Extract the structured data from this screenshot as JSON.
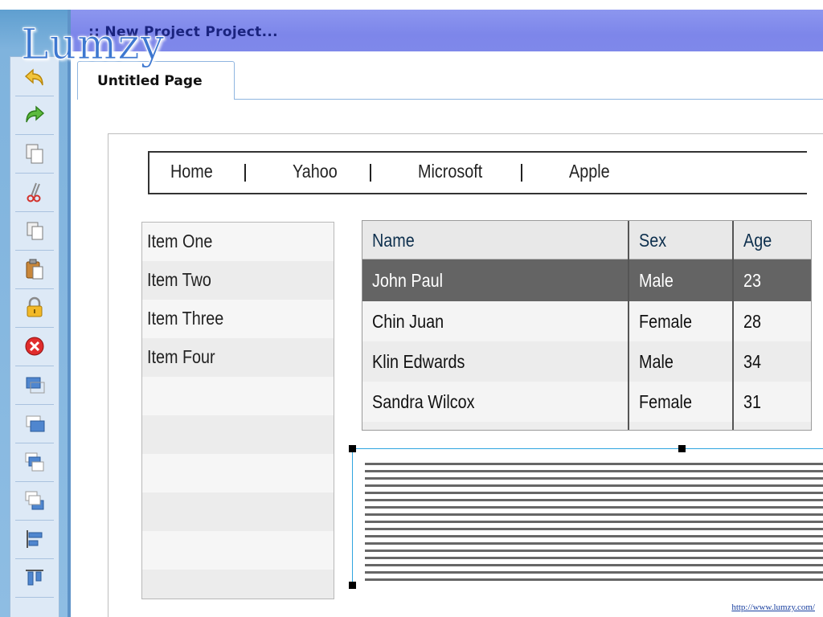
{
  "logo": "Lumzy",
  "window": {
    "title": ":: New Project Project..."
  },
  "tabs": [
    {
      "label": "Untitled Page"
    }
  ],
  "toolbar": {
    "items": [
      {
        "name": "undo-icon"
      },
      {
        "name": "redo-icon"
      },
      {
        "name": "copy-icon"
      },
      {
        "name": "cut-icon"
      },
      {
        "name": "duplicate-icon"
      },
      {
        "name": "paste-icon"
      },
      {
        "name": "lock-icon"
      },
      {
        "name": "delete-icon"
      },
      {
        "name": "bring-forward-icon"
      },
      {
        "name": "send-backward-icon"
      },
      {
        "name": "bring-to-front-icon"
      },
      {
        "name": "send-to-back-icon"
      },
      {
        "name": "align-left-icon"
      },
      {
        "name": "align-top-icon"
      }
    ]
  },
  "navbar": {
    "links": [
      "Home",
      "Yahoo",
      "Microsoft",
      "Apple"
    ]
  },
  "list": {
    "items": [
      "Item One",
      "Item Two",
      "Item Three",
      "Item Four"
    ]
  },
  "grid": {
    "columns": [
      "Name",
      "Sex",
      "Age"
    ],
    "rows": [
      [
        "John Paul",
        "Male",
        "23"
      ],
      [
        "Chin Juan",
        "Female",
        "28"
      ],
      [
        "Klin Edwards",
        "Male",
        "34"
      ],
      [
        "Sandra Wilcox",
        "Female",
        "31"
      ]
    ],
    "selected_row": 0
  },
  "footer": {
    "url": "http://www.lumzy.com/"
  },
  "colors": {
    "titlebar": "#7f88ea",
    "selected_row": "#646464",
    "selection": "#2fa5e0"
  }
}
